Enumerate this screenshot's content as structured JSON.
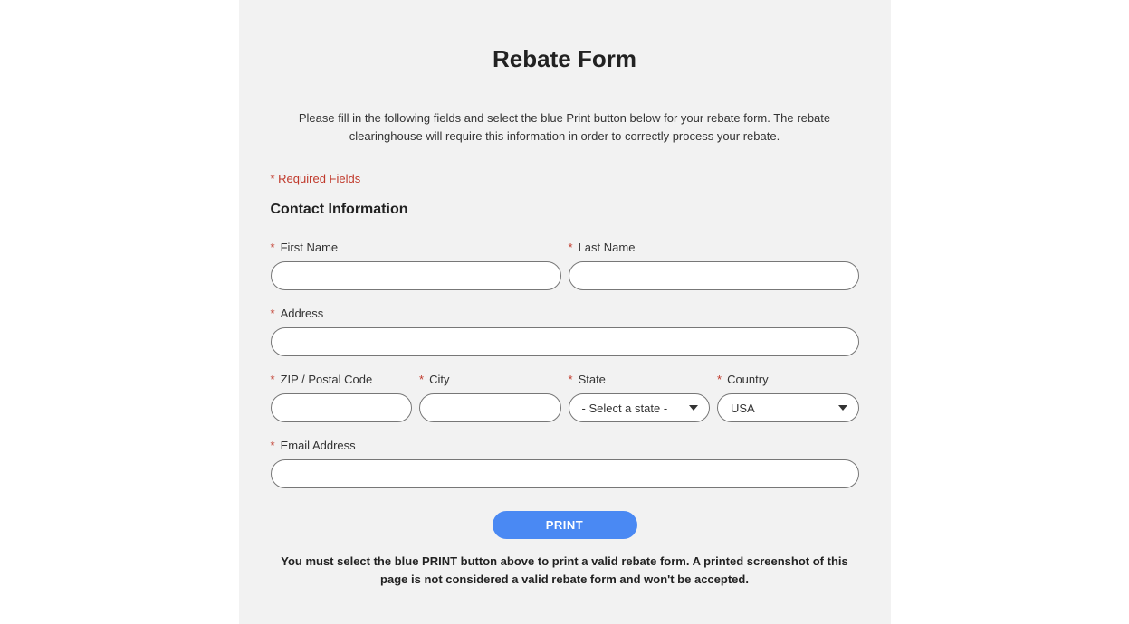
{
  "title": "Rebate Form",
  "instructions": "Please fill in the following fields and select the blue Print button below for your rebate form. The rebate clearinghouse will require this information in order to correctly process your rebate.",
  "requiredNote": "* Required Fields",
  "sectionHeading": "Contact Information",
  "fields": {
    "firstName": {
      "label": "First Name",
      "value": ""
    },
    "lastName": {
      "label": "Last Name",
      "value": ""
    },
    "address": {
      "label": "Address",
      "value": ""
    },
    "zip": {
      "label": "ZIP / Postal Code",
      "value": ""
    },
    "city": {
      "label": "City",
      "value": ""
    },
    "state": {
      "label": "State",
      "placeholder": "- Select a state -",
      "value": ""
    },
    "country": {
      "label": "Country",
      "value": "USA"
    },
    "email": {
      "label": "Email Address",
      "value": ""
    }
  },
  "printButton": "PRINT",
  "footerNote": "You must select the blue PRINT button above to print a valid rebate form. A printed screenshot of this page is not considered a valid rebate form and won't be accepted."
}
